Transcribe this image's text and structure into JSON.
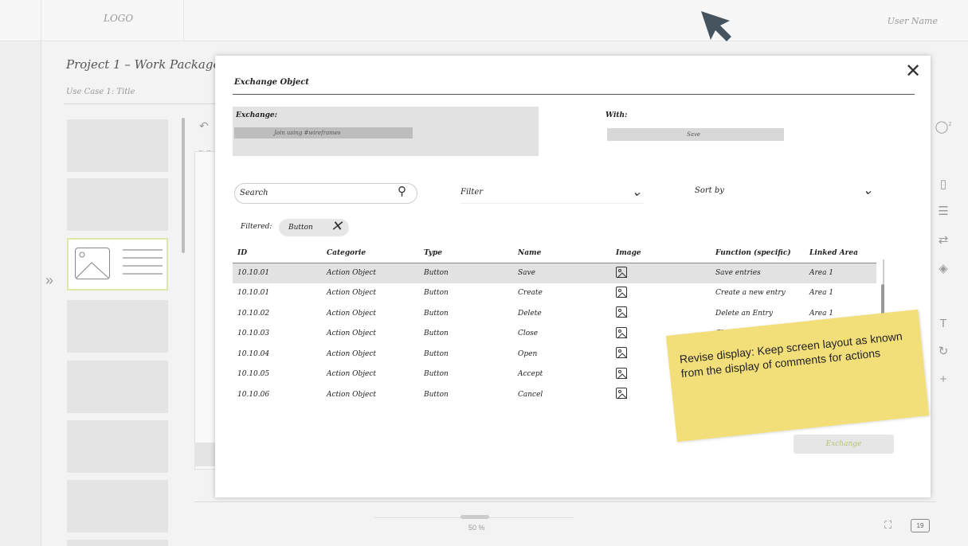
{
  "app": {
    "logo": "LOGO",
    "user": "User Name"
  },
  "project": {
    "title": "Project 1 – Work Package 1",
    "use_case": "Use Case 1: Title"
  },
  "canvas": {
    "zoom": "50 %",
    "page_badge": "19"
  },
  "modal": {
    "title": "Exchange Object",
    "exchange_label": "Exchange:",
    "exchange_value": "Join using #wireframes",
    "with_label": "With:",
    "with_value": "Save",
    "search_placeholder": "Search",
    "filter_label": "Filter",
    "sort_label": "Sort by",
    "filtered_label": "Filtered:",
    "filter_chip": "Button",
    "exchange_button": "Exchange",
    "columns": [
      "ID",
      "Categorie",
      "Type",
      "Name",
      "Image",
      "Function (specific)",
      "Linked Area"
    ],
    "rows": [
      {
        "id": "10.10.01",
        "cat": "Action Object",
        "type": "Button",
        "name": "Save",
        "fn": "Save entries",
        "area": "Area 1"
      },
      {
        "id": "10.10.01",
        "cat": "Action Object",
        "type": "Button",
        "name": "Create",
        "fn": "Create a new entry",
        "area": "Area 1"
      },
      {
        "id": "10.10.02",
        "cat": "Action Object",
        "type": "Button",
        "name": "Delete",
        "fn": "Delete an Entry",
        "area": "Area 1"
      },
      {
        "id": "10.10.03",
        "cat": "Action Object",
        "type": "Button",
        "name": "Close",
        "fn": "Close a window",
        "area": ""
      },
      {
        "id": "10.10.04",
        "cat": "Action Object",
        "type": "Button",
        "name": "Open",
        "fn": "",
        "area": ""
      },
      {
        "id": "10.10.05",
        "cat": "Action Object",
        "type": "Button",
        "name": "Accept",
        "fn": "",
        "area": ""
      },
      {
        "id": "10.10.06",
        "cat": "Action Object",
        "type": "Button",
        "name": "Cancel",
        "fn": "",
        "area": ""
      }
    ]
  },
  "note": "Revise display: Keep screen layout as known from the display of comments for actions",
  "colors": {
    "highlight_row": "#e2e2e2",
    "sticky": "#f3df7a",
    "accent_green": "#b4c46c"
  }
}
